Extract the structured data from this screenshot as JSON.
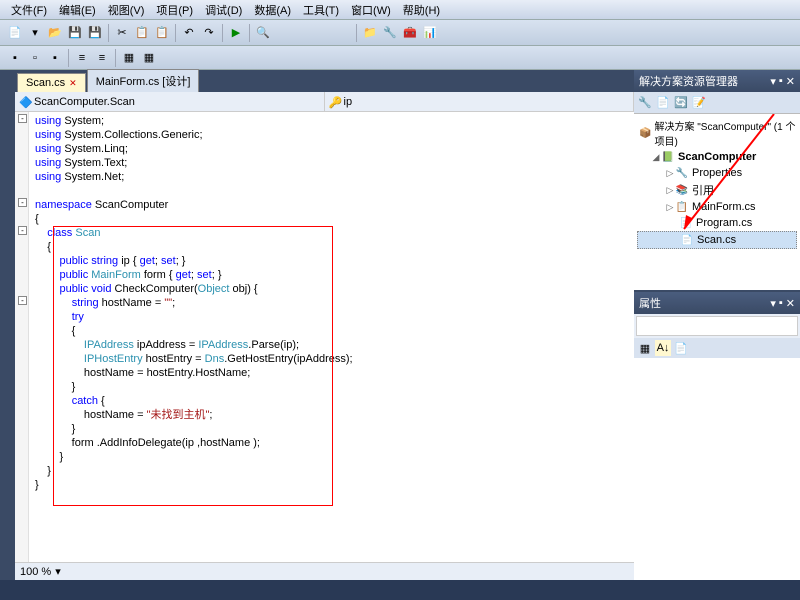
{
  "menu": {
    "file": "文件(F)",
    "edit": "编辑(E)",
    "view": "视图(V)",
    "project": "项目(P)",
    "debug": "调试(D)",
    "data": "数据(A)",
    "tools": "工具(T)",
    "window": "窗口(W)",
    "help": "帮助(H)"
  },
  "tabs": {
    "active": "Scan.cs",
    "inactive": "MainForm.cs [设计]"
  },
  "dropdowns": {
    "class": "ScanComputer.Scan",
    "member": "ip"
  },
  "code": {
    "l1": "using System;",
    "l2": "using System.Collections.Generic;",
    "l3": "using System.Linq;",
    "l4": "using System.Text;",
    "l5": "using System.Net;",
    "l6": "",
    "l7": "namespace ScanComputer",
    "l8": "{",
    "l9": "    class Scan",
    "l10": "    {",
    "l11": "        public string ip { get; set; }",
    "l12": "        public MainForm form { get; set; }",
    "l13": "        public void CheckComputer(Object obj) {",
    "l14": "            string hostName = \"\";",
    "l15": "            try",
    "l16": "            {",
    "l17": "                IPAddress ipAddress = IPAddress.Parse(ip);",
    "l18": "                IPHostEntry hostEntry = Dns.GetHostEntry(ipAddress);",
    "l19": "                hostName = hostEntry.HostName;",
    "l20": "            }",
    "l21": "            catch {",
    "l22": "                hostName = \"未找到主机\";",
    "l23": "            }",
    "l24": "            form .AddInfoDelegate(ip ,hostName );",
    "l25": "        }",
    "l26": "    }",
    "l27": "}"
  },
  "zoom": "100 %",
  "solution_explorer": {
    "title": "解决方案资源管理器",
    "solution": "解决方案 \"ScanComputer\" (1 个项目)",
    "project": "ScanComputer",
    "properties": "Properties",
    "references": "引用",
    "mainform": "MainForm.cs",
    "program": "Program.cs",
    "scan": "Scan.cs"
  },
  "properties_panel": {
    "title": "属性"
  }
}
